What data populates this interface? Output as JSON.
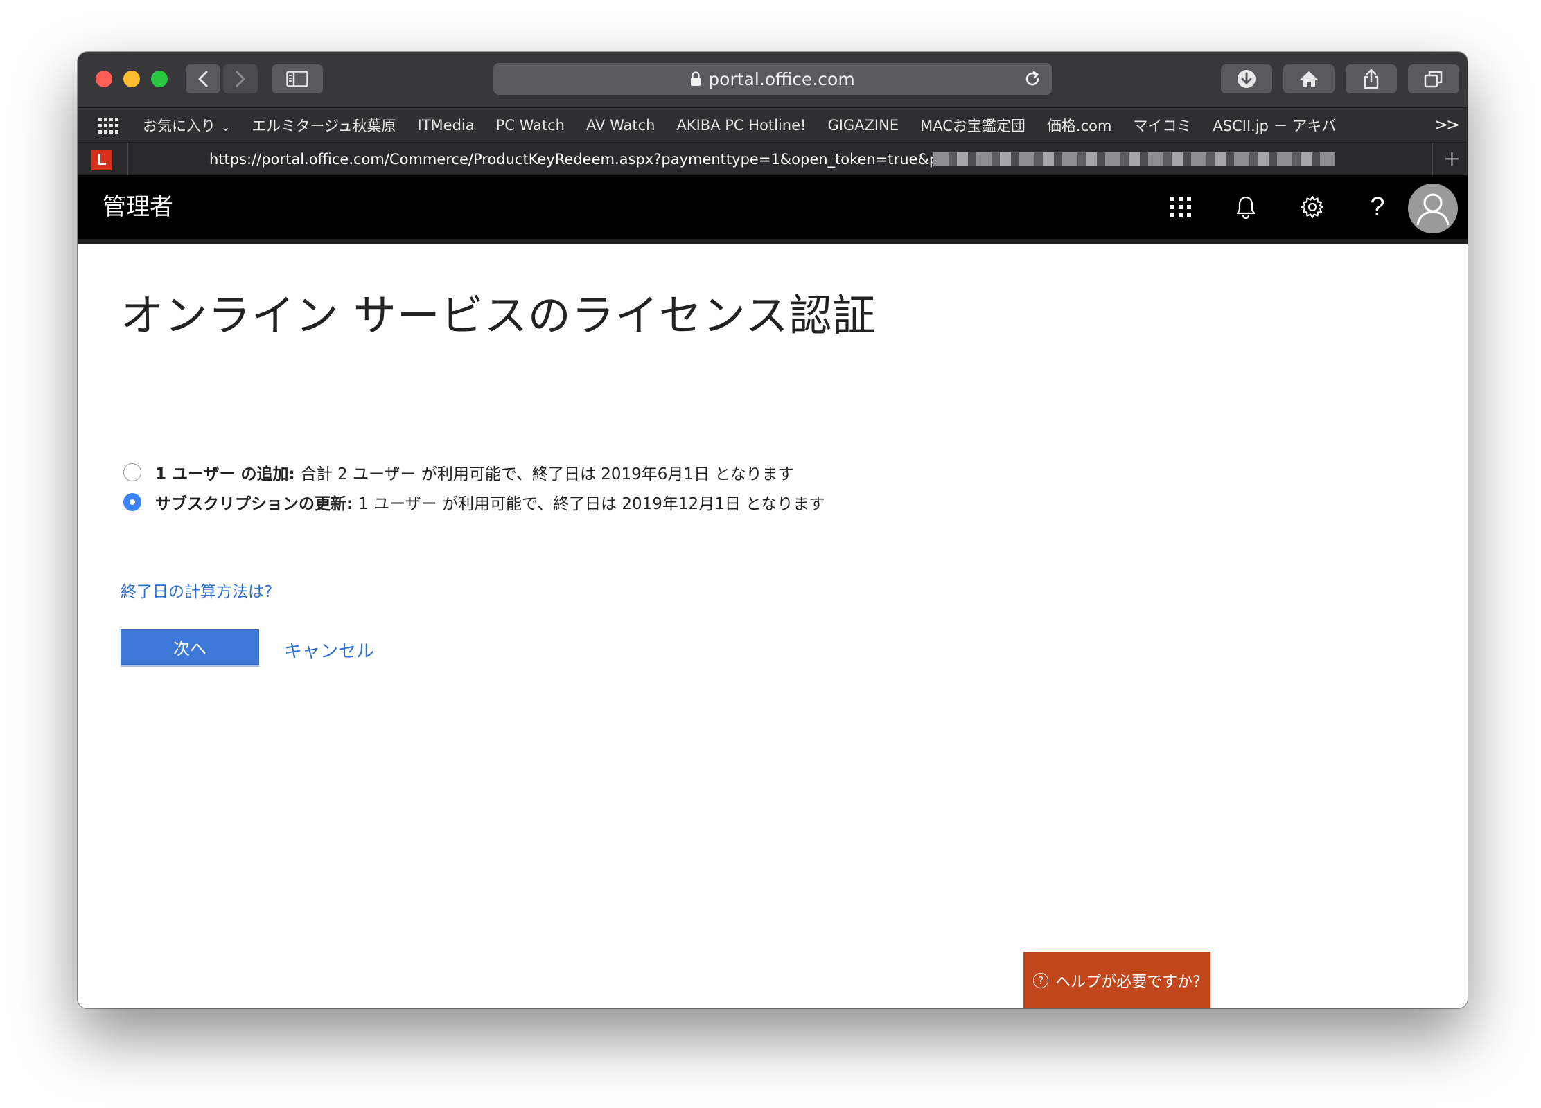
{
  "browser": {
    "address_host": "portal.office.com",
    "full_url": "https://portal.office.com/Commerce/ProductKeyRedeem.aspx?paymenttype=1&open_token=true&p",
    "favicon_letter": "L",
    "bookmarks": [
      "お気に入り",
      "エルミタージュ秋葉原",
      "ITMedia",
      "PC Watch",
      "AV Watch",
      "AKIBA PC Hotline!",
      "GIGAZINE",
      "MACお宝鑑定団",
      "価格.com",
      "マイコミ",
      "ASCII.jp － アキバ"
    ],
    "bookmarks_more": ">>"
  },
  "header": {
    "title": "管理者",
    "help_glyph": "?"
  },
  "main": {
    "page_title": "オンライン サービスのライセンス認証",
    "options": [
      {
        "bold": "1 ユーザー の追加:",
        "text": "合計 2 ユーザー が利用可能で、終了日は 2019年6月1日 となります",
        "selected": false
      },
      {
        "bold": "サブスクリプションの更新:",
        "text": "1 ユーザー が利用可能で、終了日は 2019年12月1日 となります",
        "selected": true
      }
    ],
    "calc_link": "終了日の計算方法は?",
    "next_label": "次へ",
    "cancel_label": "キャンセル"
  },
  "help_button": {
    "label": "ヘルプが必要ですか?",
    "icon_glyph": "?"
  },
  "colors": {
    "accent_blue": "#3e78d8",
    "link_blue": "#2b6fd4",
    "help_orange": "#c2461c",
    "radio_selected": "#3b82f6"
  }
}
